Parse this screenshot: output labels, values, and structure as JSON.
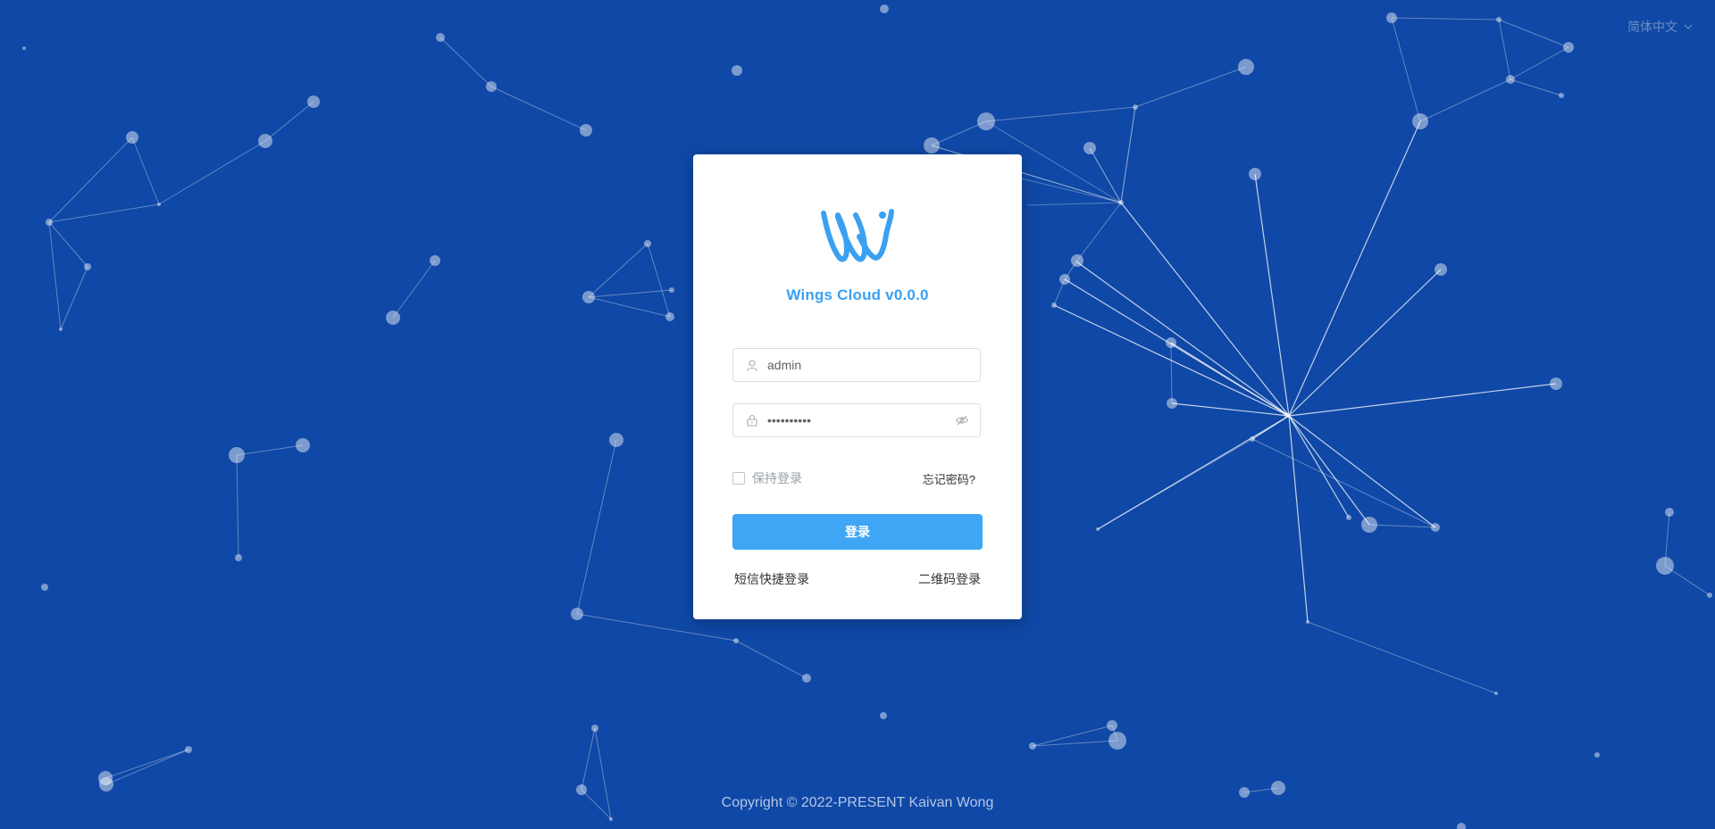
{
  "language": {
    "label": "简体中文",
    "icon": "chevron-down-icon"
  },
  "brand": {
    "logo": "wings-logo",
    "title": "Wings Cloud  v0.0.0"
  },
  "form": {
    "username": {
      "value": "admin",
      "icon": "user-icon"
    },
    "password": {
      "value": "••••••••••",
      "icon": "lock-icon",
      "toggle_icon": "eye-off-icon"
    },
    "remember_label": "保持登录",
    "remember_checked": false,
    "forgot_label": "忘记密码?",
    "submit_label": "登录",
    "sms_login_label": "短信快捷登录",
    "qr_login_label": "二维码登录"
  },
  "footer": {
    "copyright": "Copyright © 2022-PRESENT Kaivan Wong"
  },
  "colors": {
    "background": "#0f48a6",
    "accent": "#3ea6f4",
    "card": "#ffffff"
  }
}
